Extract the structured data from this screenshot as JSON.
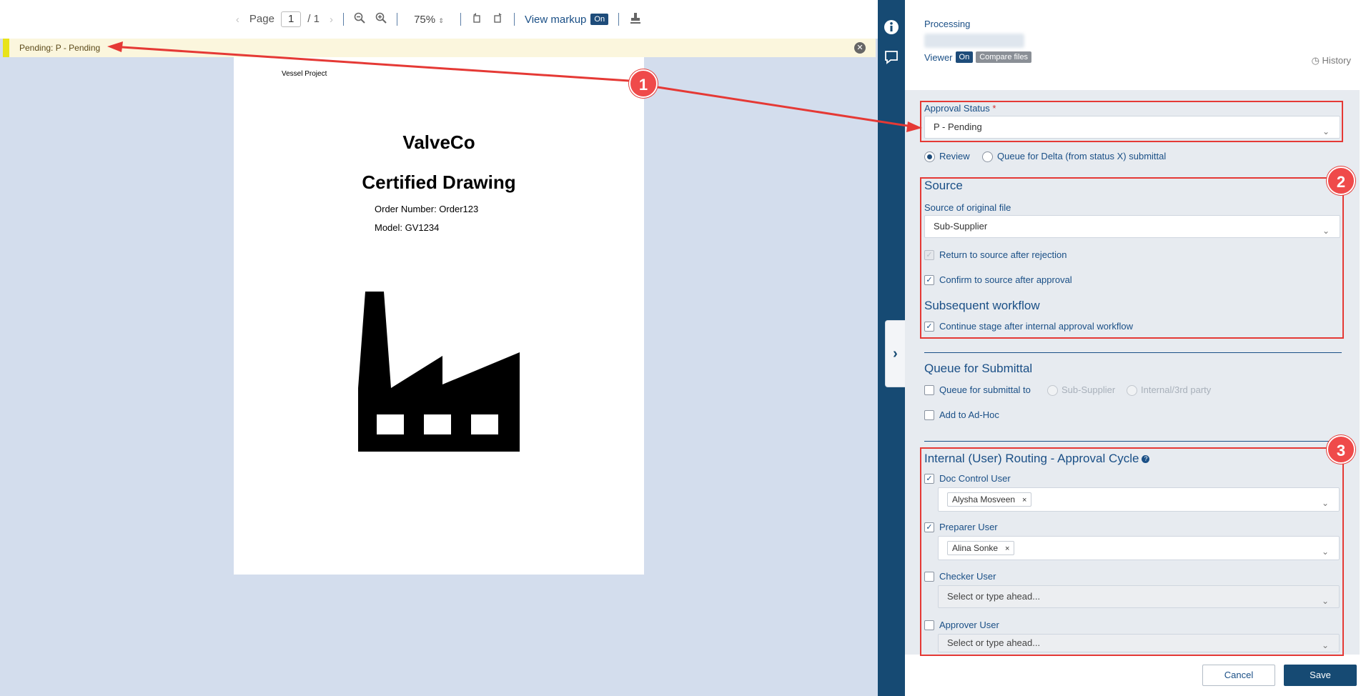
{
  "toolbar": {
    "page_label": "Page",
    "page_current": "1",
    "page_total": "/ 1",
    "zoom": "75%",
    "view_markup_label": "View markup",
    "view_markup_state": "On"
  },
  "status_bar": {
    "text": "Pending: P - Pending"
  },
  "document": {
    "header": "Vessel Project",
    "company": "ValveCo",
    "title": "Certified Drawing",
    "order": "Order Number: Order123",
    "model": "Model: GV1234"
  },
  "panel": {
    "processing": "Processing",
    "viewer_label": "Viewer",
    "viewer_state": "On",
    "compare_files": "Compare files",
    "history": "History",
    "approval_status_label": "Approval Status",
    "approval_required": "*",
    "approval_status_value": "P - Pending",
    "radio_review": "Review",
    "radio_queue_delta": "Queue for Delta (from status X) submittal",
    "source_title": "Source",
    "source_label": "Source of original file",
    "source_value": "Sub-Supplier",
    "return_source": "Return to source after rejection",
    "confirm_source": "Confirm to source after approval",
    "subsequent_title": "Subsequent workflow",
    "continue_stage": "Continue stage after internal approval workflow",
    "queue_title": "Queue for Submittal",
    "queue_submittal_to": "Queue for submittal to",
    "queue_sub_supplier": "Sub-Supplier",
    "queue_internal": "Internal/3rd party",
    "add_adhoc": "Add to Ad-Hoc",
    "routing_title": "Internal (User) Routing - Approval Cycle",
    "doc_control_user": "Doc Control User",
    "doc_control_value": "Alysha Mosveen",
    "preparer_user": "Preparer User",
    "preparer_value": "Alina Sonke",
    "checker_user": "Checker User",
    "checker_placeholder": "Select or type ahead...",
    "approver_user": "Approver User",
    "approver_placeholder": "Select or type ahead...",
    "cancel": "Cancel",
    "save": "Save"
  },
  "annotations": [
    "1",
    "2",
    "3"
  ],
  "colors": {
    "rail": "#164a73",
    "accent": "#1a4f86",
    "annotation": "#e53935",
    "status_mark": "#e8e31a"
  }
}
